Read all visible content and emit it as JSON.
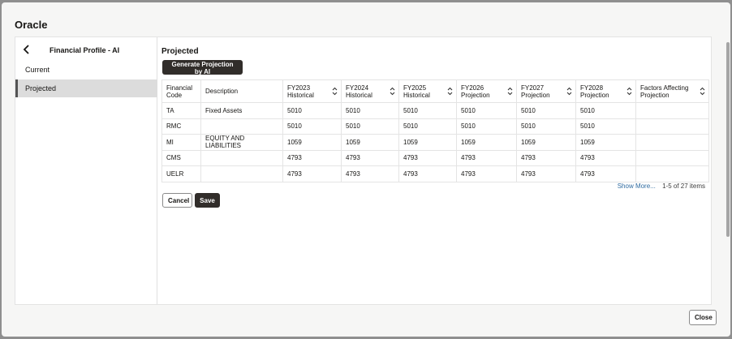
{
  "dialog": {
    "title": "Oracle",
    "close_label": "Close"
  },
  "nav": {
    "title": "Financial Profile - AI",
    "items": [
      {
        "label": "Current",
        "selected": false
      },
      {
        "label": "Projected",
        "selected": true
      }
    ]
  },
  "main": {
    "section_title": "Projected",
    "generate_label": "Generate Projection by AI",
    "table": {
      "columns": [
        {
          "line1": "Financial",
          "line2": "Code",
          "sortable": false
        },
        {
          "line1": "Description",
          "line2": "",
          "sortable": false
        },
        {
          "line1": "FY2023",
          "line2": "Historical",
          "sortable": true
        },
        {
          "line1": "FY2024",
          "line2": "Historical",
          "sortable": true
        },
        {
          "line1": "FY2025",
          "line2": "Historical",
          "sortable": true
        },
        {
          "line1": "FY2026",
          "line2": "Projection",
          "sortable": true
        },
        {
          "line1": "FY2027",
          "line2": "Projection",
          "sortable": true
        },
        {
          "line1": "FY2028",
          "line2": "Projection",
          "sortable": true
        },
        {
          "line1": "Factors Affecting",
          "line2": "Projection",
          "sortable": true
        }
      ],
      "rows": [
        [
          "TA",
          "Fixed Assets",
          "5010",
          "5010",
          "5010",
          "5010",
          "5010",
          "5010",
          ""
        ],
        [
          "RMC",
          "",
          "5010",
          "5010",
          "5010",
          "5010",
          "5010",
          "5010",
          ""
        ],
        [
          "MI",
          "EQUITY AND LIABILITIES",
          "1059",
          "1059",
          "1059",
          "1059",
          "1059",
          "1059",
          ""
        ],
        [
          "CMS",
          "",
          "4793",
          "4793",
          "4793",
          "4793",
          "4793",
          "4793",
          ""
        ],
        [
          "UELR",
          "",
          "4793",
          "4793",
          "4793",
          "4793",
          "4793",
          "4793",
          ""
        ]
      ]
    },
    "show_more_label": "Show More...",
    "pagination_text": "1-5 of 27 items",
    "cancel_label": "Cancel",
    "save_label": "Save"
  },
  "colors": {
    "accent_dark": "#312d2a",
    "link": "#2f6ba0",
    "selected_nav_bg": "#dcdcdc"
  },
  "icons": {
    "back": "chevron-left-icon",
    "sort": "sort-icon"
  }
}
